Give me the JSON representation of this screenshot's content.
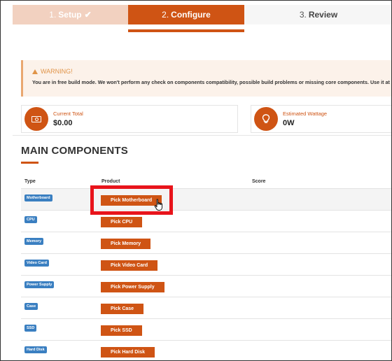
{
  "stepper": {
    "steps": [
      {
        "number": "1.",
        "label": "Setup",
        "check": "✔"
      },
      {
        "number": "2.",
        "label": "Configure"
      },
      {
        "number": "3.",
        "label": "Review"
      }
    ]
  },
  "warning": {
    "title": "WARNING!",
    "text": "You are in free build mode. We won't perform any check on components compatibility, possible build problems or missing core components. Use it at y"
  },
  "stats": {
    "total": {
      "label": "Current Total",
      "value": "$0.00",
      "icon": "money-icon"
    },
    "wattage": {
      "label": "Estimated Wattage",
      "value": "0W",
      "icon": "lightbulb-icon"
    }
  },
  "section": {
    "title": "MAIN COMPONENTS"
  },
  "table": {
    "headers": {
      "type": "Type",
      "product": "Product",
      "score": "Score"
    },
    "rows": [
      {
        "type": "Motherboard",
        "button": "Pick Motherboard"
      },
      {
        "type": "CPU",
        "button": "Pick CPU"
      },
      {
        "type": "Memory",
        "button": "Pick Memory"
      },
      {
        "type": "Video Card",
        "button": "Pick Video Card"
      },
      {
        "type": "Power Supply",
        "button": "Pick Power Supply"
      },
      {
        "type": "Case",
        "button": "Pick Case"
      },
      {
        "type": "SSD",
        "button": "Pick SSD"
      },
      {
        "type": "Hard Disk",
        "button": "Pick Hard Disk"
      }
    ]
  },
  "colors": {
    "accent": "#cf5414",
    "badge": "#3a7fc1",
    "highlight": "#e8141b"
  }
}
